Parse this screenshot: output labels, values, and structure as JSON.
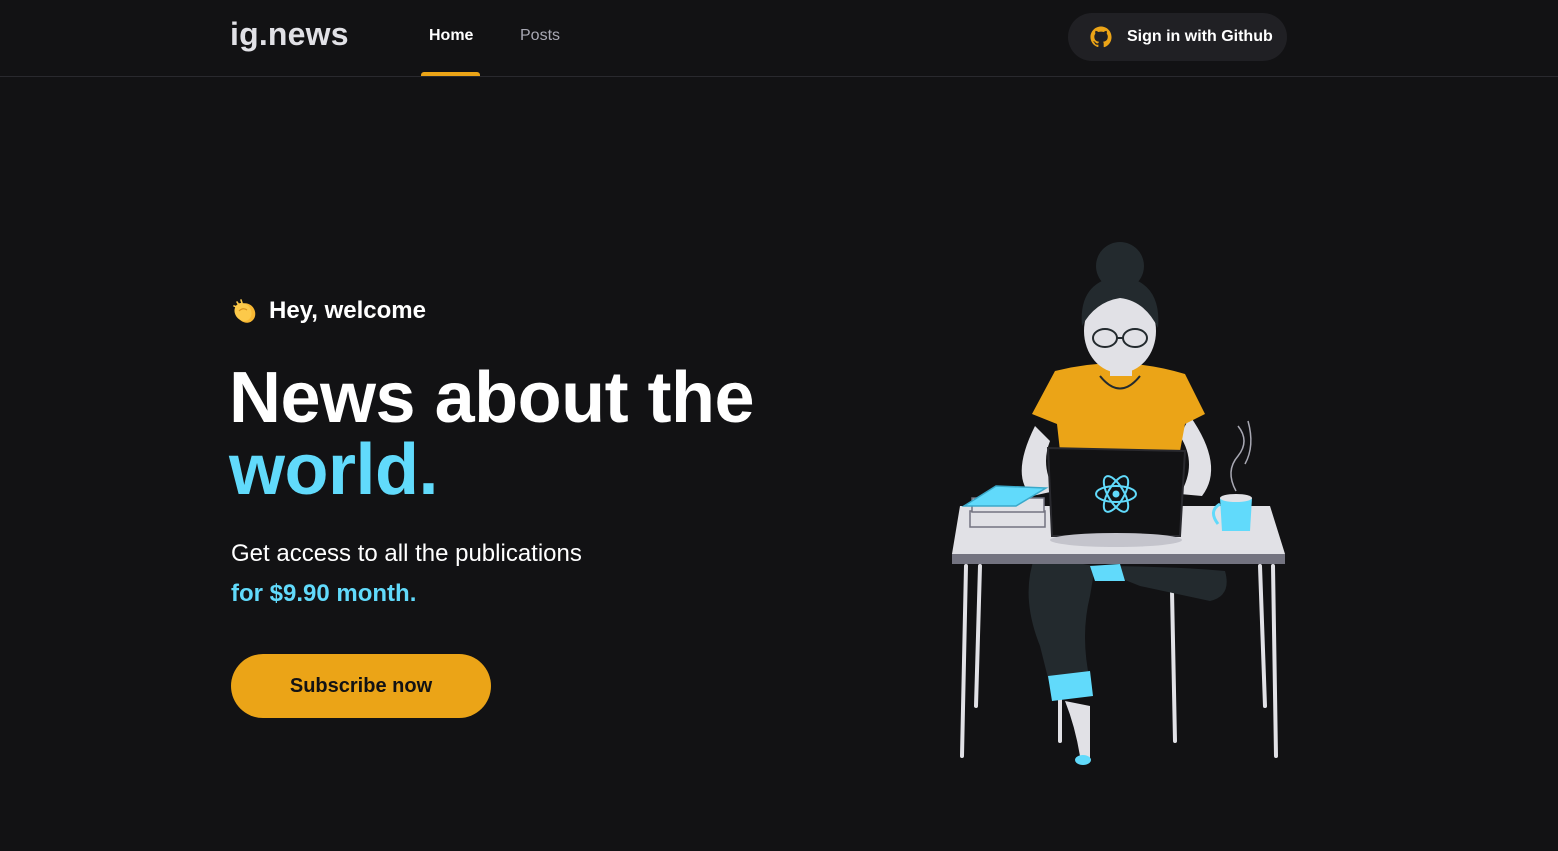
{
  "header": {
    "logo": "ig.news",
    "nav": [
      {
        "label": "Home",
        "active": true
      },
      {
        "label": "Posts",
        "active": false
      }
    ],
    "signin_label": "Sign in with Github"
  },
  "hero": {
    "welcome": "Hey, welcome",
    "headline_line1": "News about the",
    "headline_accent": "world.",
    "subtitle": "Get access to all the publications",
    "price": "for $9.90 month.",
    "cta_label": "Subscribe now"
  },
  "colors": {
    "background": "#121214",
    "accent_yellow": "#eba417",
    "accent_cyan": "#61dafb",
    "surface": "#202024"
  },
  "icons": {
    "signin": "github-icon",
    "welcome": "clapping-hands-icon",
    "illustration": "woman-at-laptop-illustration"
  }
}
